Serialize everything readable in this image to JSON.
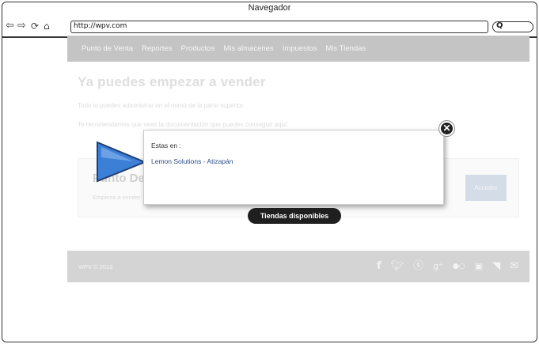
{
  "window": {
    "title": "Navegador"
  },
  "toolbar": {
    "url": "http://wpv.com",
    "icons": [
      "back-arrow-icon",
      "forward-arrow-icon",
      "reload-icon",
      "home-icon",
      "search-icon"
    ]
  },
  "nav": {
    "items": [
      {
        "label": "Punto de Venta"
      },
      {
        "label": "Reportes"
      },
      {
        "label": "Productos"
      },
      {
        "label": "Mis almacenes"
      },
      {
        "label": "Impuestos"
      },
      {
        "label": "Mis Tiendas"
      }
    ]
  },
  "hero": {
    "title": "Ya puedes empezar a vender",
    "line1": "Todo lo puedes administrar en el menú de la parte superior.",
    "line2": "Te recomendamos que veas la documentación que puedes conseguir aquí."
  },
  "store": {
    "title": "Punto De V",
    "subtitle": "Empieza a vender",
    "access_label": "Acceder"
  },
  "popup": {
    "label": "Estas en :",
    "store_link": "Lemon Solutions - Atizapán",
    "close_glyph": "✕"
  },
  "stores_button": {
    "label": "Tiendas disponibles"
  },
  "footer": {
    "copyright": "WPV © 2013",
    "social": [
      "facebook-icon",
      "twitter-icon",
      "skype-icon",
      "google-plus-icon",
      "flickr-icon",
      "youtube-icon",
      "rss-icon",
      "mail-icon"
    ]
  },
  "colors": {
    "nav_bg": "#c4c4c4",
    "footer_bg": "#d4d4d4",
    "arrow_blue": "#3b7fd6",
    "pill_bg": "#1f1f1f",
    "link": "#2f4e8a"
  }
}
